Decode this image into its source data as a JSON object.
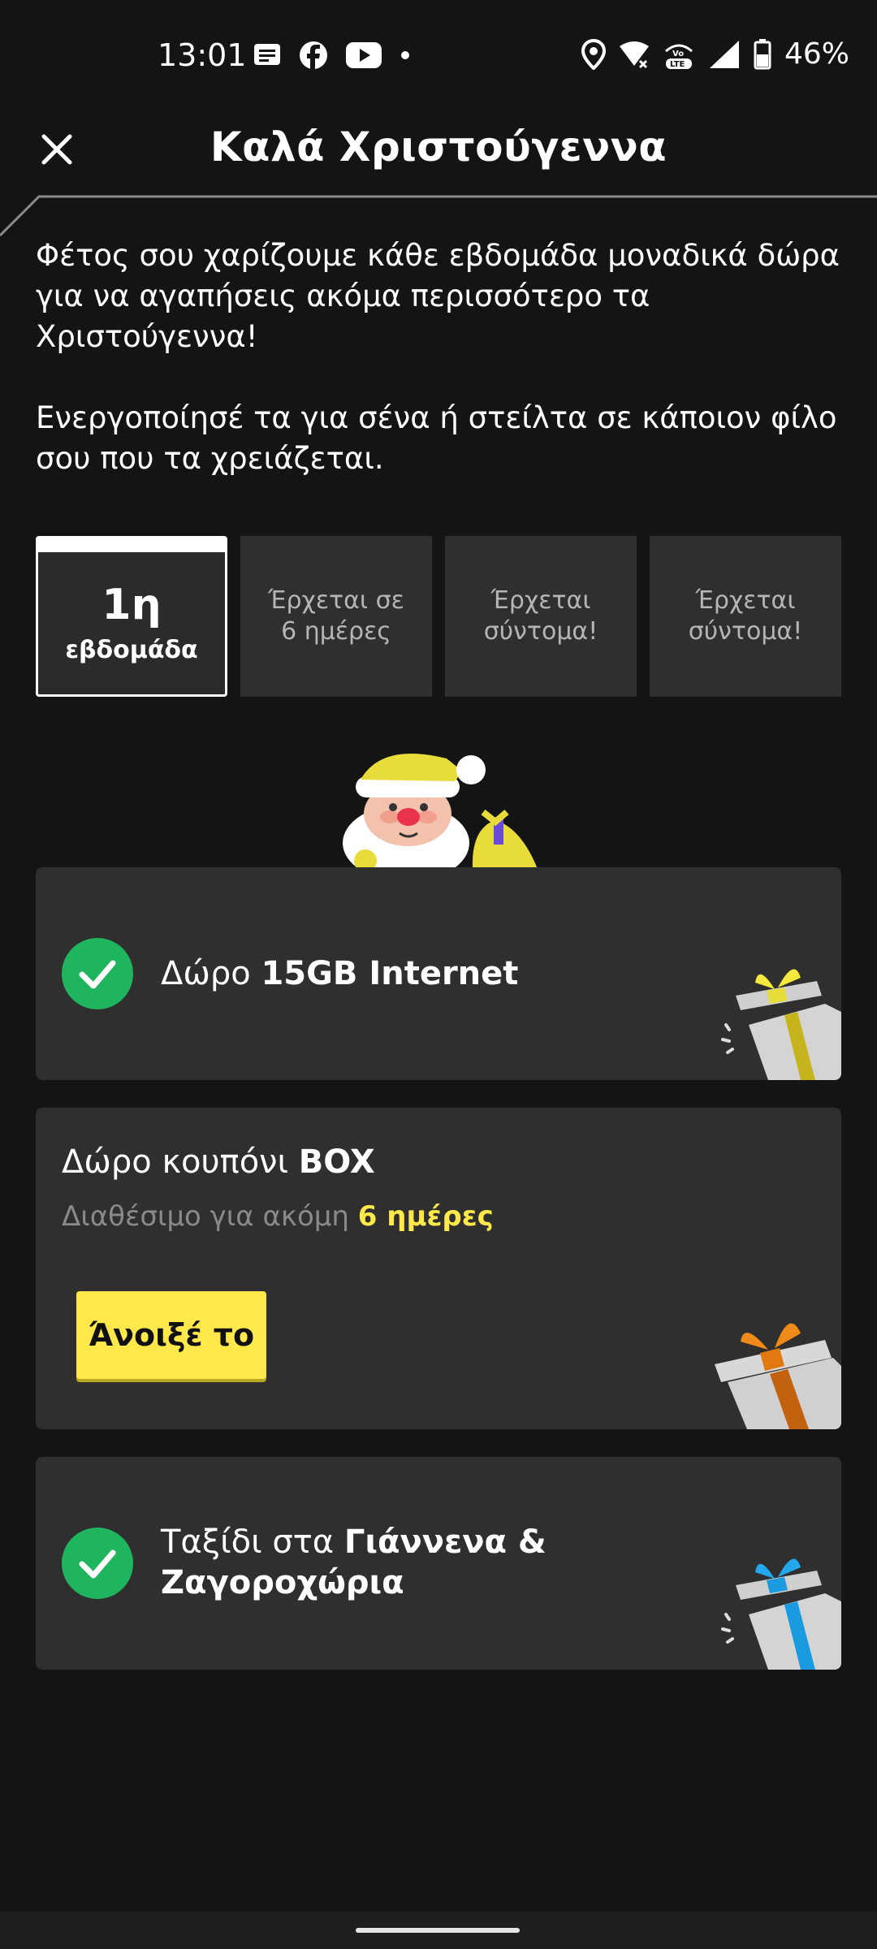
{
  "status_bar": {
    "time": "13:01",
    "battery": "46%",
    "left_icons": [
      "message-icon",
      "facebook-icon",
      "youtube-icon",
      "dot-icon"
    ],
    "right_icons": [
      "location-icon",
      "wifi-icon",
      "volte-icon",
      "signal-icon",
      "battery-icon"
    ]
  },
  "header": {
    "title": "Καλά Χριστούγεννα",
    "close_icon": "close-icon"
  },
  "intro": {
    "paragraph1": "Φέτος σου χαρίζουμε κάθε εβδομάδα μοναδικά δώρα για να αγαπήσεις ακόμα περισσότερο τα Χριστούγεννα!",
    "paragraph2": "Ενεργοποίησέ τα για σένα ή στείλτα σε κάποιον φίλο σου που τα χρειάζεται."
  },
  "tabs": [
    {
      "main": "1η",
      "sub": "εβδομάδα",
      "active": true
    },
    {
      "label": "Έρχεται σε 6 ημέρες"
    },
    {
      "label": "Έρχεται σύντομα!"
    },
    {
      "label": "Έρχεται σύντομα!"
    }
  ],
  "cards": {
    "internet": {
      "prefix": "Δώρο ",
      "bold": "15GB Internet"
    },
    "coupon": {
      "title_prefix": "Δώρο κουπόνι ",
      "title_bold": "BOX",
      "sub_prefix": "Διαθέσιμο για ακόμη ",
      "sub_days": "6 ημέρες",
      "button": "Άνοιξέ το"
    },
    "trip": {
      "prefix": "Ταξίδι στα ",
      "bold_line1": "Γιάννενα &",
      "bold_line2": "Ζαγοροχώρια"
    }
  },
  "colors": {
    "background": "#141414",
    "card": "#2f2f2f",
    "accent_yellow": "#ffe94a",
    "check_green": "#1fb55e"
  }
}
